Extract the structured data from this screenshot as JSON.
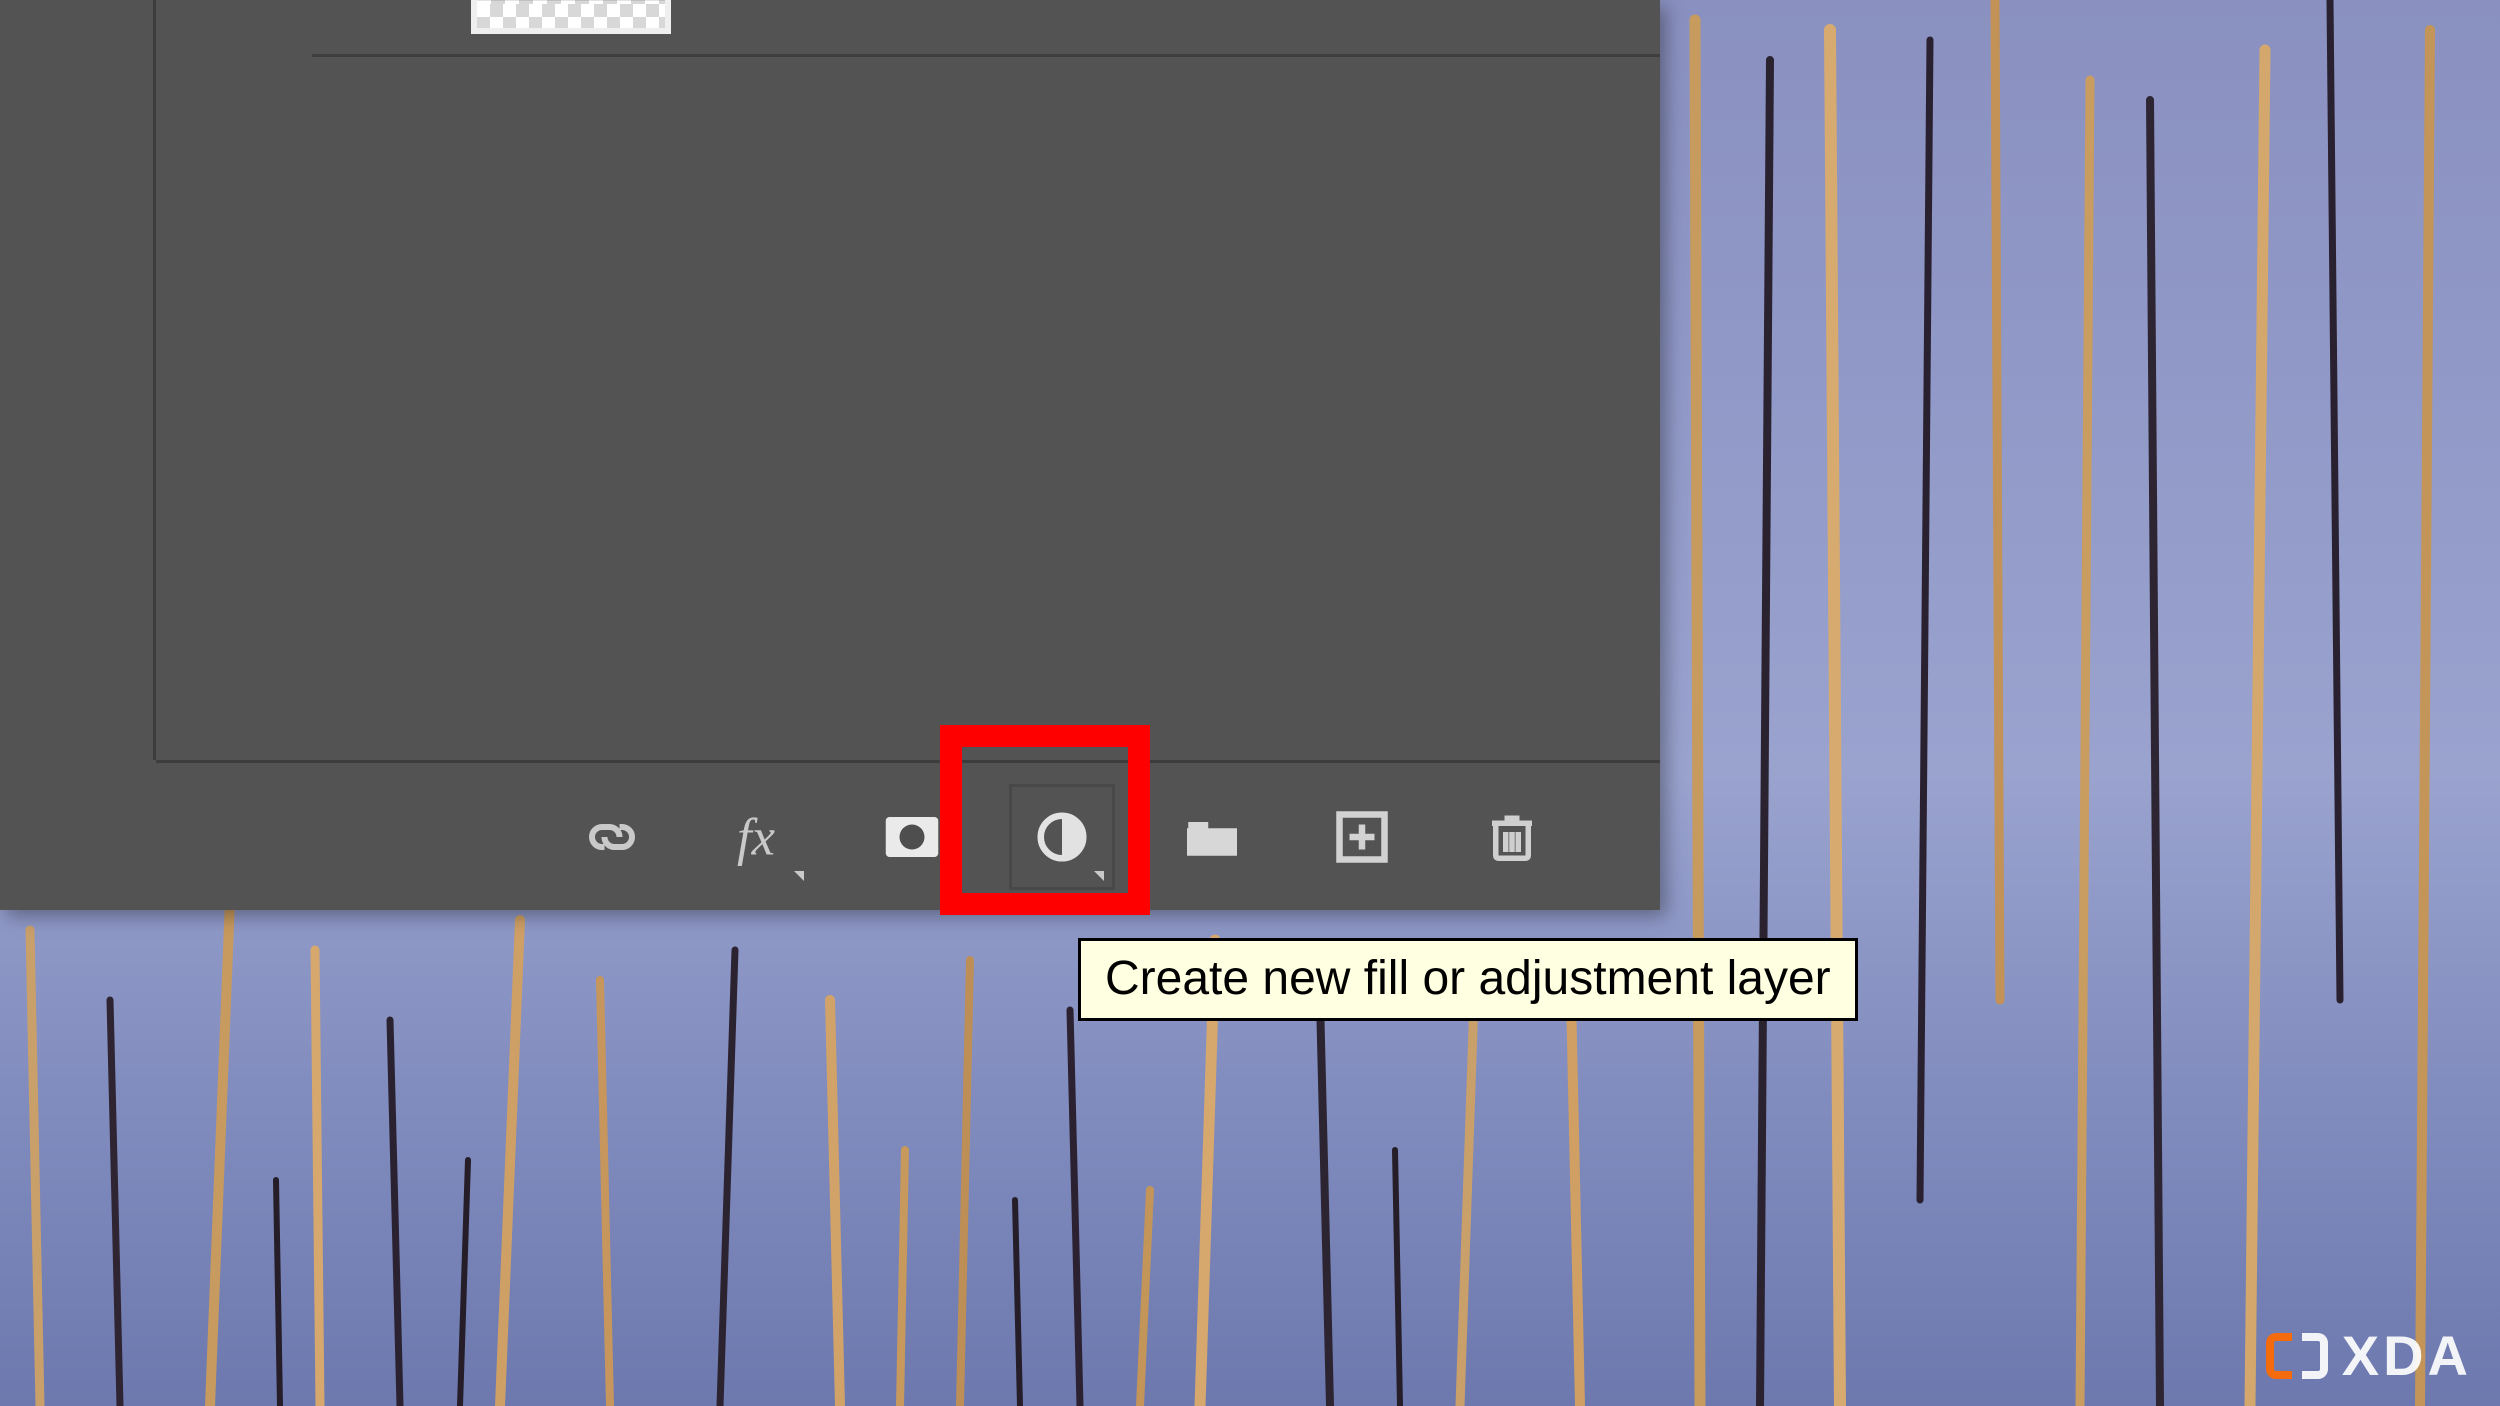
{
  "panel": {
    "icons": {
      "link": "link-layers-icon",
      "fx": "layer-style-fx-icon",
      "mask": "add-layer-mask-icon",
      "adjustment": "fill-adjustment-layer-icon",
      "group": "new-group-folder-icon",
      "new": "new-layer-plus-icon",
      "trash": "delete-layer-trash-icon"
    }
  },
  "tooltip": {
    "text": "Create new fill or adjustment layer"
  },
  "watermark": {
    "text": "XDA"
  },
  "highlight": {
    "target": "fill-adjustment-layer-button"
  }
}
